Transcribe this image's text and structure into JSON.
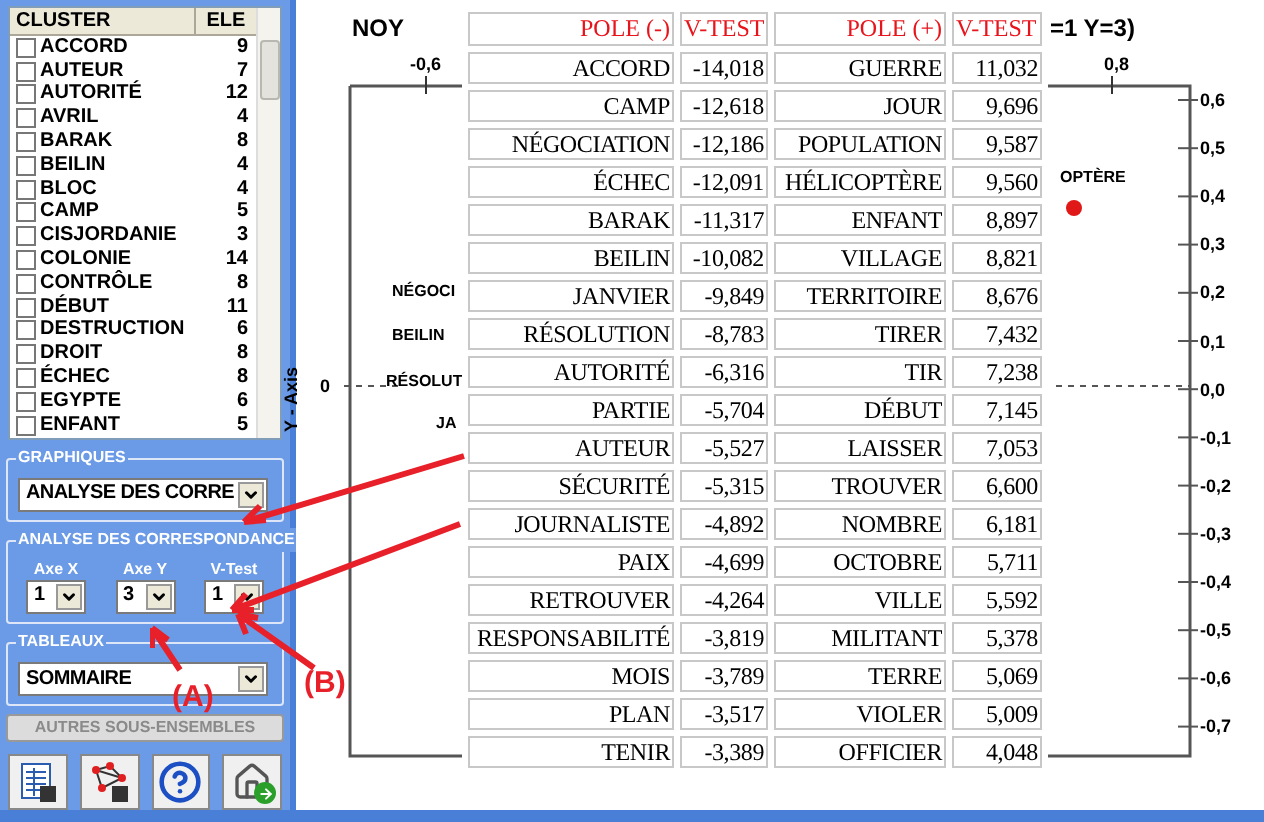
{
  "cluster_list": {
    "columns": [
      "CLUSTER",
      "ELE"
    ],
    "rows": [
      {
        "label": "ACCORD",
        "count": "9",
        "checked": false
      },
      {
        "label": "AUTEUR",
        "count": "7",
        "checked": false
      },
      {
        "label": "AUTORITÉ",
        "count": "12",
        "checked": false
      },
      {
        "label": "AVRIL",
        "count": "4",
        "checked": false
      },
      {
        "label": "BARAK",
        "count": "8",
        "checked": false
      },
      {
        "label": "BEILIN",
        "count": "4",
        "checked": false
      },
      {
        "label": "BLOC",
        "count": "4",
        "checked": false
      },
      {
        "label": "CAMP",
        "count": "5",
        "checked": false
      },
      {
        "label": "CISJORDANIE",
        "count": "3",
        "checked": false
      },
      {
        "label": "COLONIE",
        "count": "14",
        "checked": false
      },
      {
        "label": "CONTRÔLE",
        "count": "8",
        "checked": false
      },
      {
        "label": "DÉBUT",
        "count": "11",
        "checked": false
      },
      {
        "label": "DESTRUCTION",
        "count": "6",
        "checked": false
      },
      {
        "label": "DROIT",
        "count": "8",
        "checked": false
      },
      {
        "label": "ÉCHEC",
        "count": "8",
        "checked": false
      },
      {
        "label": "EGYPTE",
        "count": "6",
        "checked": false
      },
      {
        "label": "ENFANT",
        "count": "5",
        "checked": false
      }
    ]
  },
  "graphiques": {
    "title": "GRAPHIQUES",
    "value": "ANALYSE DES CORRE"
  },
  "analyse": {
    "title": "ANALYSE DES CORRESPONDANCE",
    "fields": [
      {
        "label": "Axe X",
        "value": "1"
      },
      {
        "label": "Axe Y",
        "value": "3"
      },
      {
        "label": "V-Test",
        "value": "1"
      }
    ]
  },
  "tableaux": {
    "title": "TABLEAUX",
    "value": "SOMMAIRE"
  },
  "other_button": {
    "label": "AUTRES SOUS-ENSEMBLES",
    "disabled": true
  },
  "chart": {
    "title_left": "NOY",
    "title_right": "=1 Y=3)",
    "y_axis_label": "Y - Axis",
    "left_tick": "0",
    "top_ticks": [
      "-0,6",
      "0,8"
    ],
    "right_ticks": [
      "0,6",
      "0,5",
      "0,4",
      "0,3",
      "0,2",
      "0,1",
      "0,0",
      "-0,1",
      "-0,2",
      "-0,3",
      "-0,4",
      "-0,5",
      "-0,6",
      "-0,7"
    ],
    "points": [
      {
        "label": "NÉGOCI",
        "marker": false
      },
      {
        "label": "BEILIN",
        "marker": false
      },
      {
        "label": "RÉSOLUT",
        "marker": false
      },
      {
        "label": "JA",
        "marker": false
      },
      {
        "label": "OPTÈRE",
        "marker": true
      }
    ]
  },
  "vtest_table": {
    "columns": [
      "POLE (-)",
      "V-TEST",
      "POLE (+)",
      "V-TEST"
    ],
    "rows": [
      [
        "ACCORD",
        "-14,018",
        "GUERRE",
        "11,032"
      ],
      [
        "CAMP",
        "-12,618",
        "JOUR",
        "9,696"
      ],
      [
        "NÉGOCIATION",
        "-12,186",
        "POPULATION",
        "9,587"
      ],
      [
        "ÉCHEC",
        "-12,091",
        "HÉLICOPTÈRE",
        "9,560"
      ],
      [
        "BARAK",
        "-11,317",
        "ENFANT",
        "8,897"
      ],
      [
        "BEILIN",
        "-10,082",
        "VILLAGE",
        "8,821"
      ],
      [
        "JANVIER",
        "-9,849",
        "TERRITOIRE",
        "8,676"
      ],
      [
        "RÉSOLUTION",
        "-8,783",
        "TIRER",
        "7,432"
      ],
      [
        "AUTORITÉ",
        "-6,316",
        "TIR",
        "7,238"
      ],
      [
        "PARTIE",
        "-5,704",
        "DÉBUT",
        "7,145"
      ],
      [
        "AUTEUR",
        "-5,527",
        "LAISSER",
        "7,053"
      ],
      [
        "SÉCURITÉ",
        "-5,315",
        "TROUVER",
        "6,600"
      ],
      [
        "JOURNALISTE",
        "-4,892",
        "NOMBRE",
        "6,181"
      ],
      [
        "PAIX",
        "-4,699",
        "OCTOBRE",
        "5,711"
      ],
      [
        "RETROUVER",
        "-4,264",
        "VILLE",
        "5,592"
      ],
      [
        "RESPONSABILITÉ",
        "-3,819",
        "MILITANT",
        "5,378"
      ],
      [
        "MOIS",
        "-3,789",
        "TERRE",
        "5,069"
      ],
      [
        "PLAN",
        "-3,517",
        "VIOLER",
        "5,009"
      ],
      [
        "TENIR",
        "-3,389",
        "OFFICIER",
        "4,048"
      ]
    ]
  },
  "annotations": [
    {
      "label": "(A)"
    },
    {
      "label": "(B)"
    }
  ]
}
